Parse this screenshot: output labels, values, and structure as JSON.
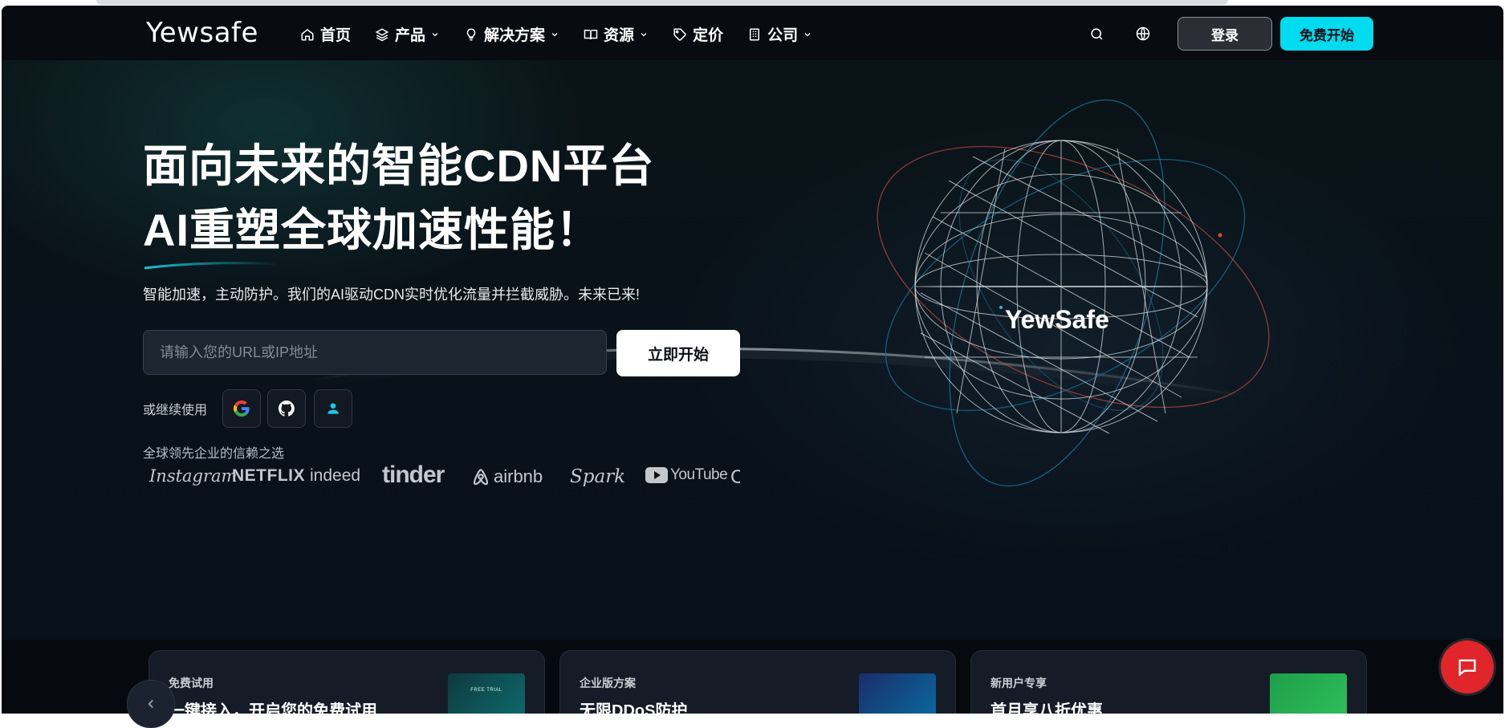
{
  "brand": {
    "logo_text": "Yewsafe"
  },
  "nav": {
    "items": [
      {
        "label": "首页",
        "icon": "home-icon",
        "has_dropdown": false
      },
      {
        "label": "产品",
        "icon": "layers-icon",
        "has_dropdown": true
      },
      {
        "label": "解决方案",
        "icon": "lightbulb-icon",
        "has_dropdown": true
      },
      {
        "label": "资源",
        "icon": "book-icon",
        "has_dropdown": true
      },
      {
        "label": "定价",
        "icon": "tag-icon",
        "has_dropdown": false
      },
      {
        "label": "公司",
        "icon": "building-icon",
        "has_dropdown": true
      }
    ],
    "login_label": "登录",
    "start_label": "免费开始"
  },
  "hero": {
    "headline_line1": "面向未来的智能CDN平台",
    "headline_line2": "AI重塑全球加速性能！",
    "subtitle": "智能加速，主动防护。我们的AI驱动CDN实时优化流量并拦截威胁。未来已来!",
    "input_placeholder": "请输入您的URL或IP地址",
    "input_value": "",
    "cta_label": "立即开始",
    "continue_label": "或继续使用",
    "social_logins": [
      "google-icon",
      "github-icon",
      "user-icon"
    ],
    "trusted_label": "全球领先企业的信赖之选",
    "brands": [
      "Instagram",
      "NETFLIX",
      "indeed",
      "tinder",
      "airbnb",
      "Spark",
      "YouTube"
    ],
    "globe_label": "YewSafe"
  },
  "cards": [
    {
      "tag": "免费试用",
      "title": "一键接入，开启您的免费试用",
      "thumb_text": "FREE TRIAL"
    },
    {
      "tag": "企业版方案",
      "title": "无限DDoS防护",
      "thumb_text": ""
    },
    {
      "tag": "新用户专享",
      "title": "首月享八折优惠",
      "thumb_text": ""
    }
  ],
  "colors": {
    "accent": "#00dbf0",
    "background": "#070b12",
    "chat_button": "#e0262a"
  }
}
